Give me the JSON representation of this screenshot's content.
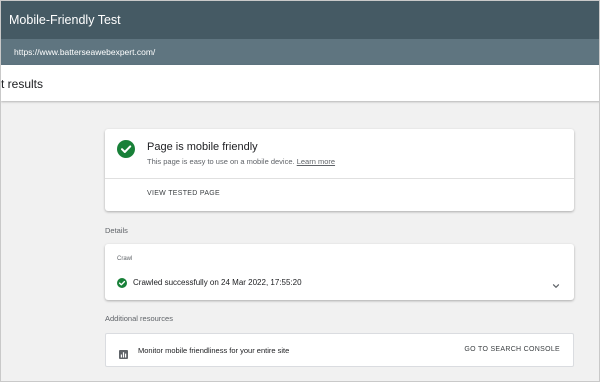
{
  "window": {
    "title": "Mobile-Friendly Test",
    "url": "https://www.batterseawebexpert.com/"
  },
  "results_header": "st results",
  "result_card": {
    "title": "Page is mobile friendly",
    "subtitle": "This page is easy to use on a mobile device.",
    "learn_more": "Learn more",
    "view_tested_page": "VIEW TESTED PAGE",
    "status_color": "#188038",
    "status_icon": "check-circle-icon"
  },
  "details": {
    "label": "Details",
    "crawl_label": "Crawl",
    "crawl_text": "Crawled successfully on 24 Mar 2022, 17:55:20",
    "expand_icon": "chevron-down-icon"
  },
  "additional": {
    "label": "Additional resources",
    "monitor_text": "Monitor mobile friendliness for your entire site",
    "console_button": "GO TO SEARCH CONSOLE",
    "icon": "bar-chart-icon"
  },
  "colors": {
    "titlebar": "#455a64",
    "urlbar": "#5f7580",
    "accent_green": "#188038"
  }
}
